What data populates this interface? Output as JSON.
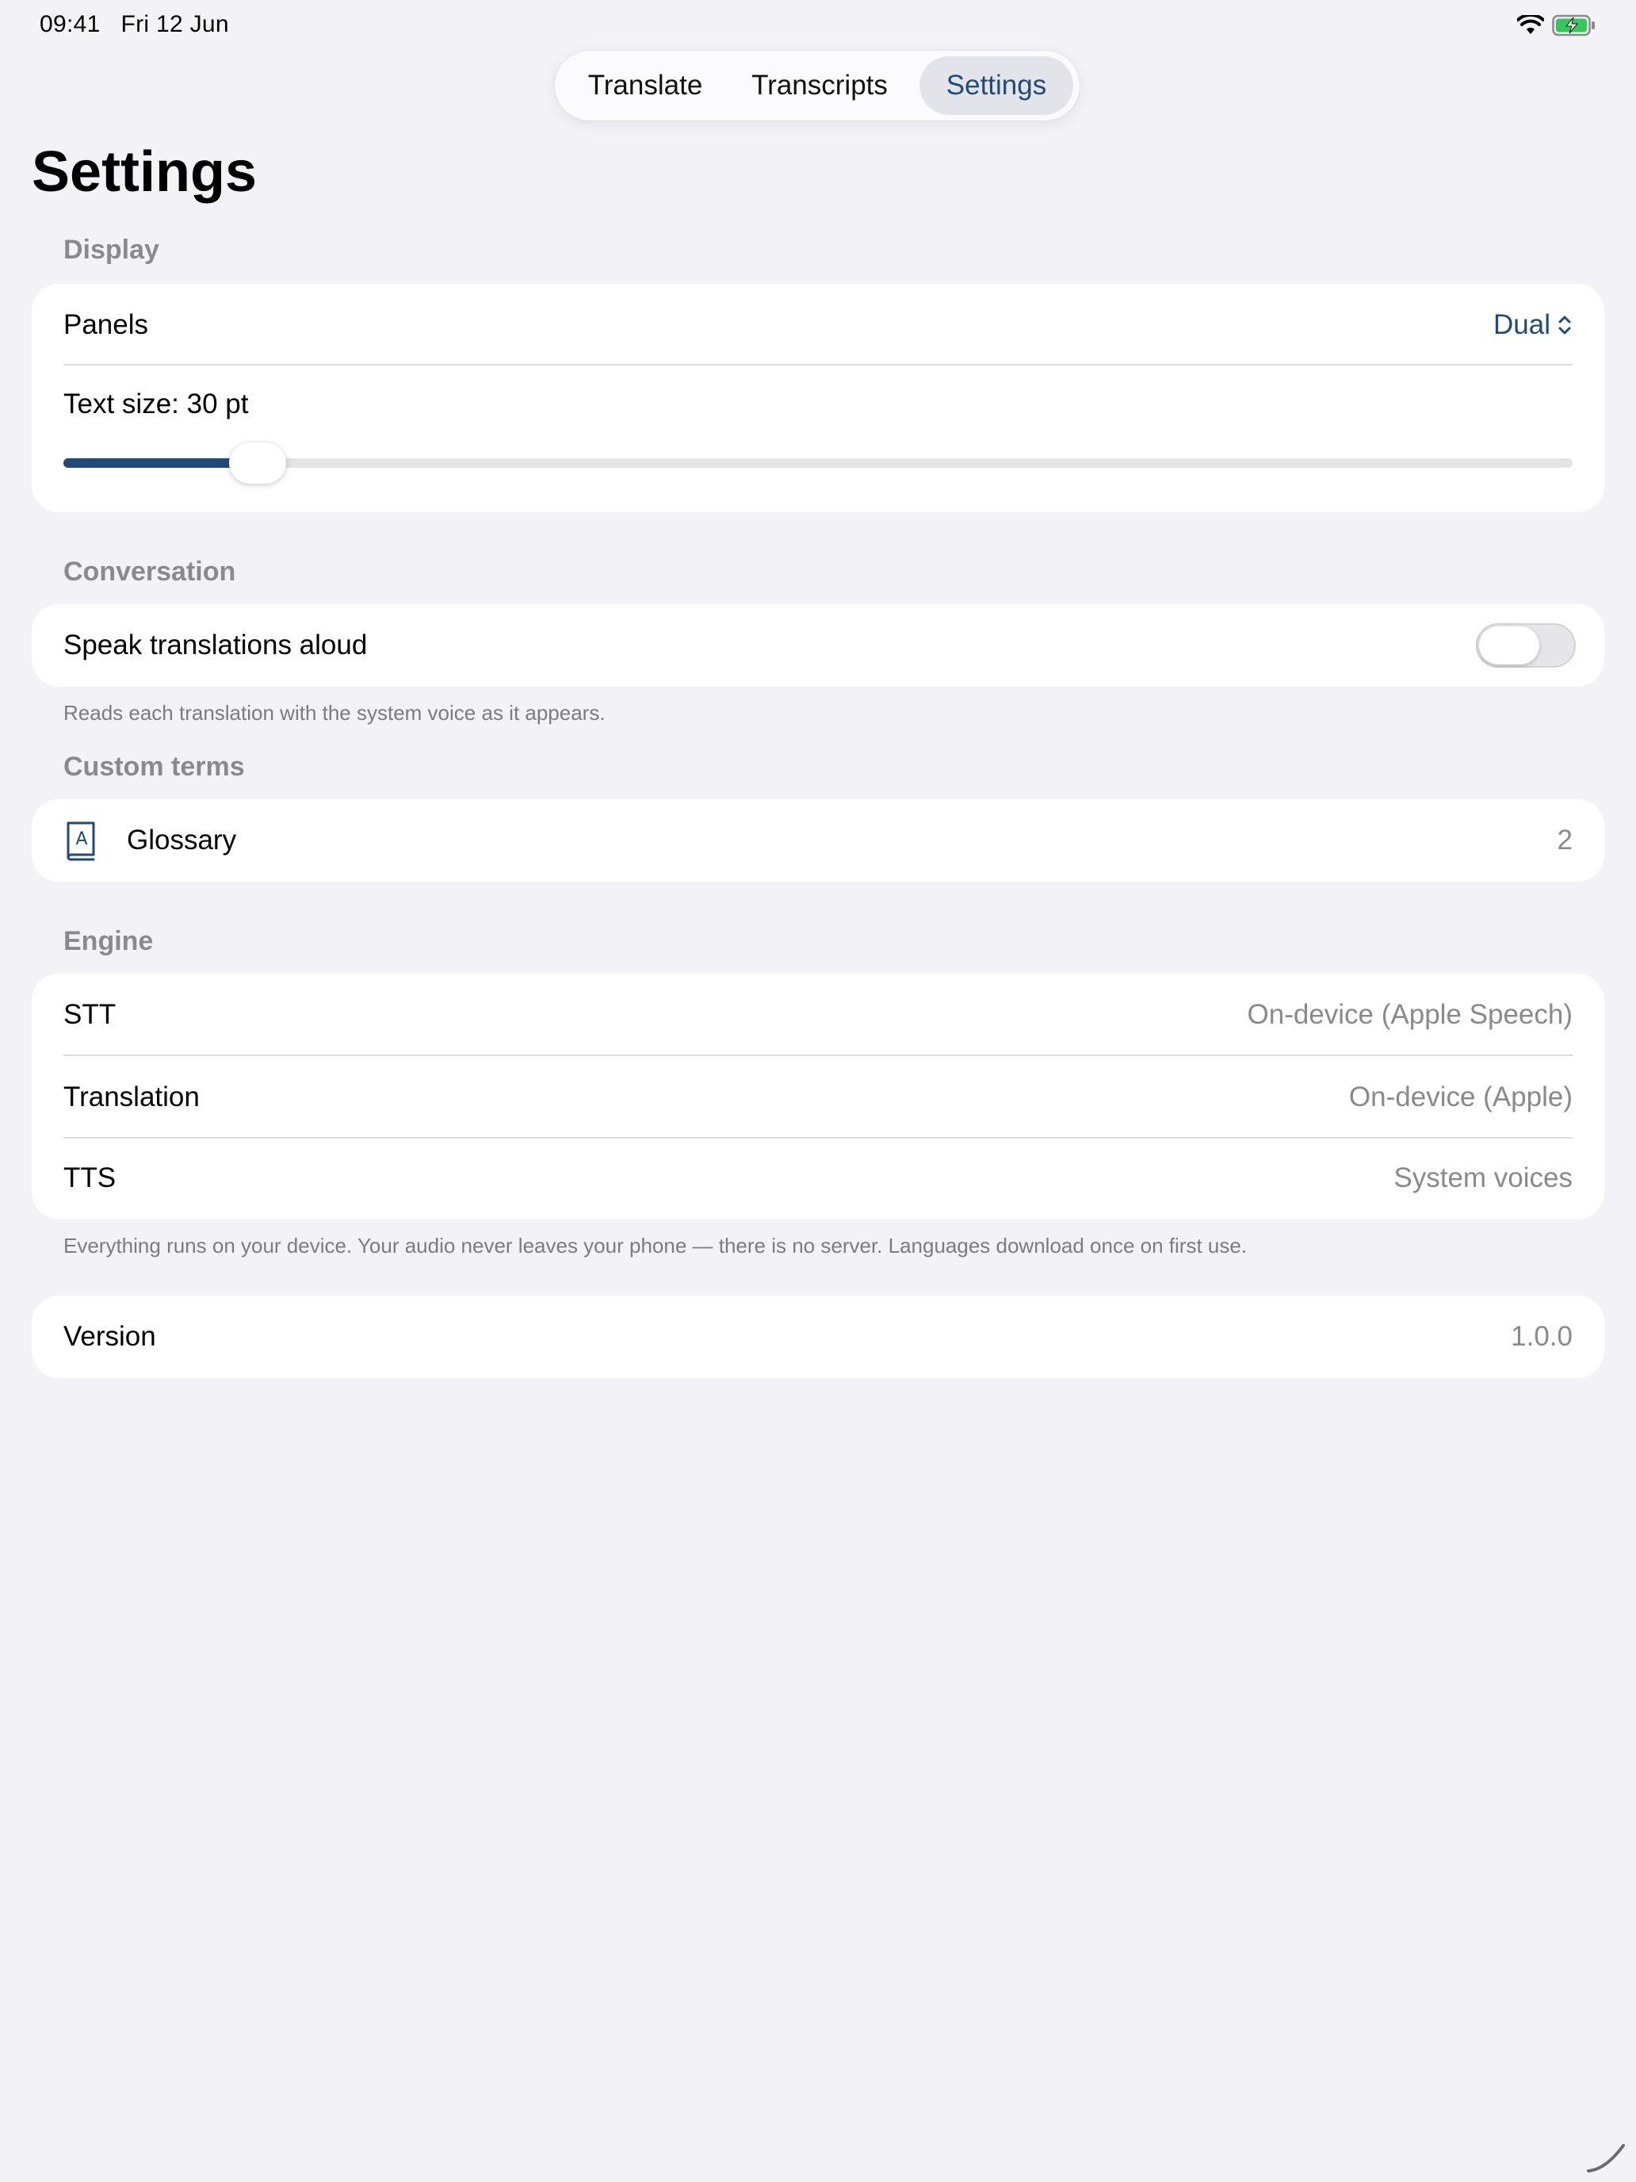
{
  "status_bar": {
    "time": "09:41",
    "date": "Fri 12 Jun",
    "icons": [
      "wifi-icon",
      "battery-charging-icon"
    ]
  },
  "tabs": [
    {
      "label": "Translate",
      "selected": false
    },
    {
      "label": "Transcripts",
      "selected": false
    },
    {
      "label": "Settings",
      "selected": true
    }
  ],
  "page_title": "Settings",
  "display": {
    "header": "Display",
    "panels_label": "Panels",
    "panels_value": "Dual",
    "text_size_label": "Text size: 30 pt",
    "text_size_fraction": 0.11
  },
  "conversation": {
    "header": "Conversation",
    "speak_label": "Speak translations aloud",
    "speak_enabled": false,
    "footnote": "Reads each translation with the system voice as it appears."
  },
  "custom_terms": {
    "header": "Custom terms",
    "icon": "book-a-icon",
    "glossary_label": "Glossary",
    "glossary_count": "2"
  },
  "engine": {
    "header": "Engine",
    "rows": [
      {
        "label": "STT",
        "value": "On-device (Apple Speech)"
      },
      {
        "label": "Translation",
        "value": "On-device (Apple)"
      },
      {
        "label": "TTS",
        "value": "System voices"
      }
    ],
    "footnote": "Everything runs on your device. Your audio never leaves your phone — there is no server. Languages download once on first use."
  },
  "version": {
    "label": "Version",
    "value": "1.0.0"
  },
  "colors": {
    "accent": "#1f4a7a",
    "background": "#f2f2f7",
    "secondary_text": "#8a8a8e",
    "battery": "#34c759"
  }
}
